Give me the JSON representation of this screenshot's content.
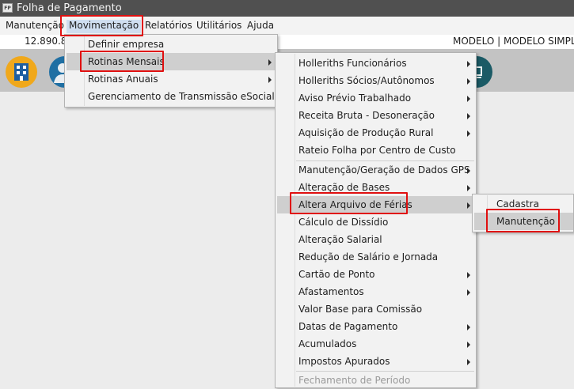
{
  "window": {
    "title": "Folha de Pagamento",
    "icon_text": "FP"
  },
  "menubar": [
    {
      "label": "Manutenção"
    },
    {
      "label": "Movimentação"
    },
    {
      "label": "Relatórios"
    },
    {
      "label": "Utilitários"
    },
    {
      "label": "Ajuda"
    }
  ],
  "infobar": {
    "left": "12.890.8",
    "right": "MODELO | MODELO SIMPLE"
  },
  "toolbar": {
    "icons": [
      "building-icon",
      "user-icon",
      "app-icon"
    ],
    "icon_colors": [
      "#f0a81b",
      "#1f6fa3",
      "#1b5b66"
    ]
  },
  "menu_movimentacao": [
    {
      "label": "Definir empresa"
    },
    {
      "label": "Rotinas Mensais"
    },
    {
      "label": "Rotinas Anuais"
    },
    {
      "label": "Gerenciamento de Transmissão eSocial"
    }
  ],
  "menu_rotinas_mensais": [
    {
      "label": "Holleriths Funcionários"
    },
    {
      "label": "Holleriths Sócios/Autônomos"
    },
    {
      "label": "Aviso Prévio Trabalhado"
    },
    {
      "label": "Receita Bruta - Desoneração"
    },
    {
      "label": "Aquisição de Produção Rural"
    },
    {
      "label": "Rateio Folha por Centro de Custo"
    },
    {
      "label": "Manutenção/Geração de Dados GPS"
    },
    {
      "label": "Alteração de Bases"
    },
    {
      "label": "Altera Arquivo de Férias"
    },
    {
      "label": "Cálculo de Dissídio"
    },
    {
      "label": "Alteração Salarial"
    },
    {
      "label": "Redução de Salário e Jornada"
    },
    {
      "label": "Cartão de Ponto"
    },
    {
      "label": "Afastamentos"
    },
    {
      "label": "Valor Base para Comissão"
    },
    {
      "label": "Datas de Pagamento"
    },
    {
      "label": "Acumulados"
    },
    {
      "label": "Impostos Apurados"
    },
    {
      "label": "Fechamento de Período"
    }
  ],
  "menu_altera_ferias": [
    {
      "label": "Cadastra"
    },
    {
      "label": "Manutenção"
    }
  ],
  "highlight_color": "#e01010"
}
